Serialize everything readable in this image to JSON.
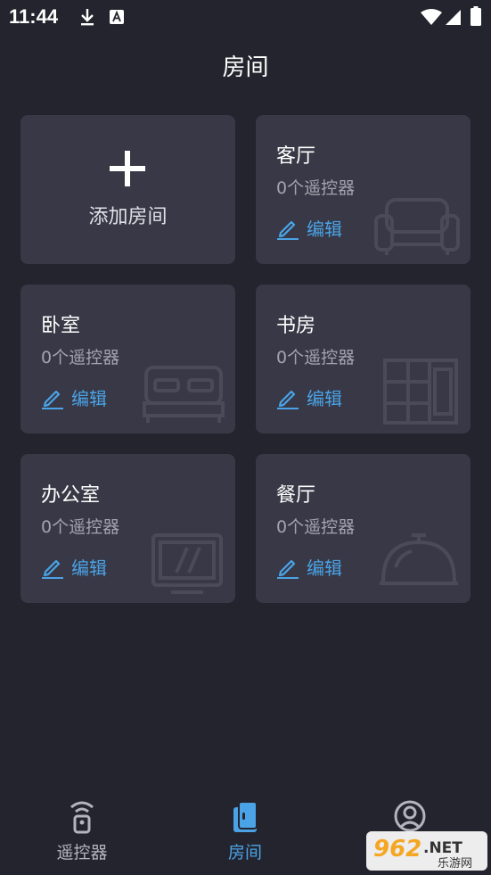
{
  "status_bar": {
    "time": "11:44"
  },
  "header": {
    "title": "房间"
  },
  "add_room": {
    "label": "添加房间"
  },
  "rooms": [
    {
      "name": "客厅",
      "count": "0个遥控器",
      "edit_label": "编辑",
      "icon": "sofa-icon"
    },
    {
      "name": "卧室",
      "count": "0个遥控器",
      "edit_label": "编辑",
      "icon": "bed-icon"
    },
    {
      "name": "书房",
      "count": "0个遥控器",
      "edit_label": "编辑",
      "icon": "bookshelf-icon"
    },
    {
      "name": "办公室",
      "count": "0个遥控器",
      "edit_label": "编辑",
      "icon": "monitor-icon"
    },
    {
      "name": "餐厅",
      "count": "0个遥控器",
      "edit_label": "编辑",
      "icon": "cloche-icon"
    }
  ],
  "bottom_nav": {
    "items": [
      {
        "label": "遥控器",
        "icon": "remote-icon",
        "active": false
      },
      {
        "label": "房间",
        "icon": "door-icon",
        "active": true
      },
      {
        "label": "",
        "icon": "user-icon",
        "active": false
      }
    ]
  },
  "badge": {
    "number": "962",
    "suffix": ".NET",
    "subtitle": "乐游网"
  },
  "colors": {
    "background": "#24242e",
    "card": "#383846",
    "accent": "#4aa3e6",
    "muted_text": "#a4a4b0",
    "nav_inactive": "#b4b4be"
  }
}
